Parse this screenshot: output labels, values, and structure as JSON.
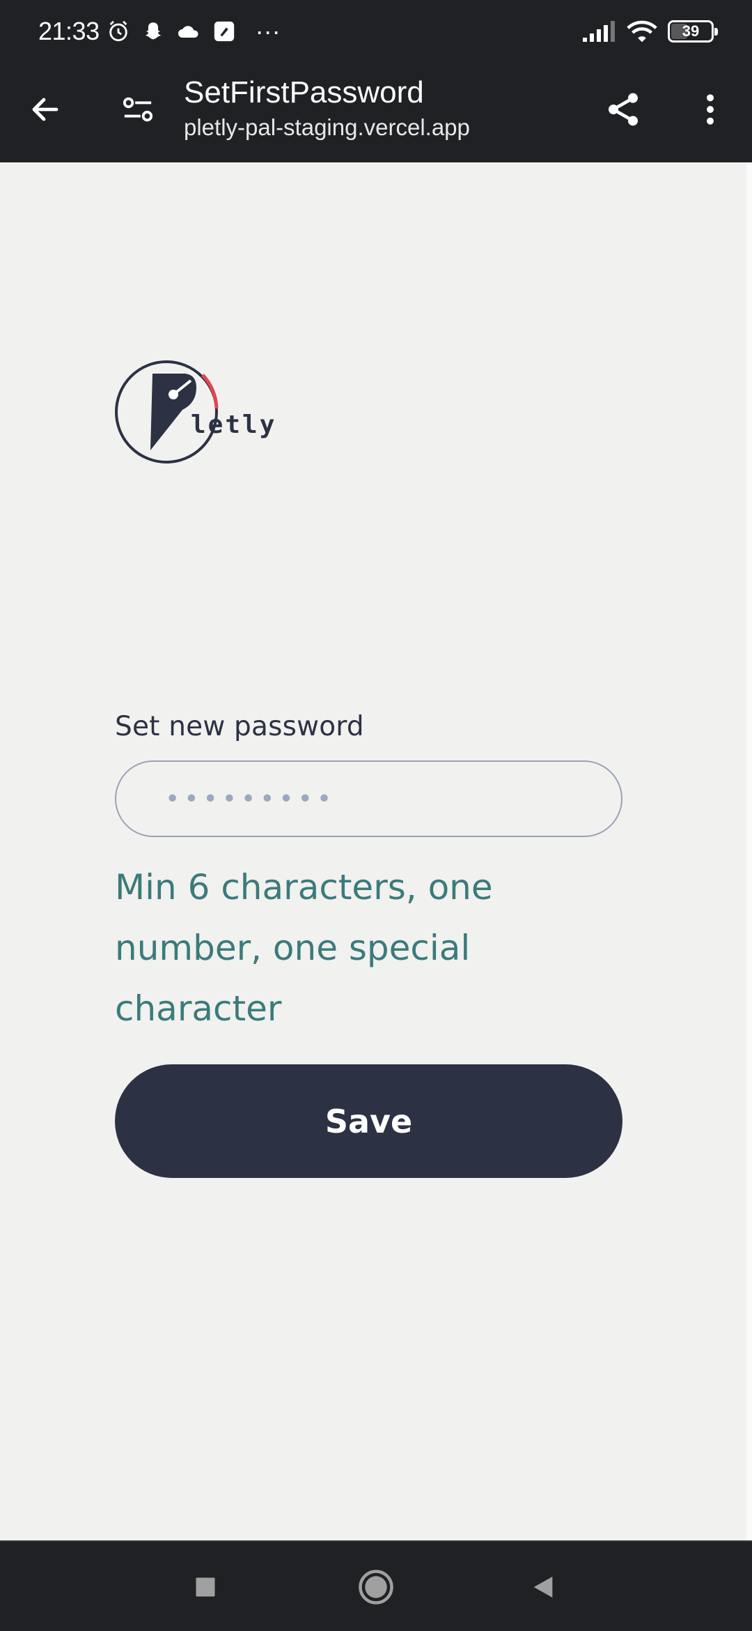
{
  "status_bar": {
    "time": "21:33",
    "battery": "39",
    "overflow": "···"
  },
  "browser": {
    "title": "SetFirstPassword",
    "url": "pletly-pal-staging.vercel.app"
  },
  "logo": {
    "text": "letly"
  },
  "form": {
    "label": "Set new password",
    "password_value": "•••••••••",
    "hint": "Min 6 characters, one number, one special character",
    "save_label": "Save"
  },
  "colors": {
    "accent": "#3b7b7a",
    "button": "#2c3244",
    "logo_arc": "#e0474c"
  },
  "icons": [
    "back-arrow-icon",
    "tune-icon",
    "share-icon",
    "more-vert-icon",
    "alarm-icon",
    "snapchat-icon",
    "cloud-icon",
    "signal-icon",
    "wifi-icon",
    "battery-icon",
    "square-icon",
    "home-circle-icon",
    "back-triangle-icon"
  ]
}
